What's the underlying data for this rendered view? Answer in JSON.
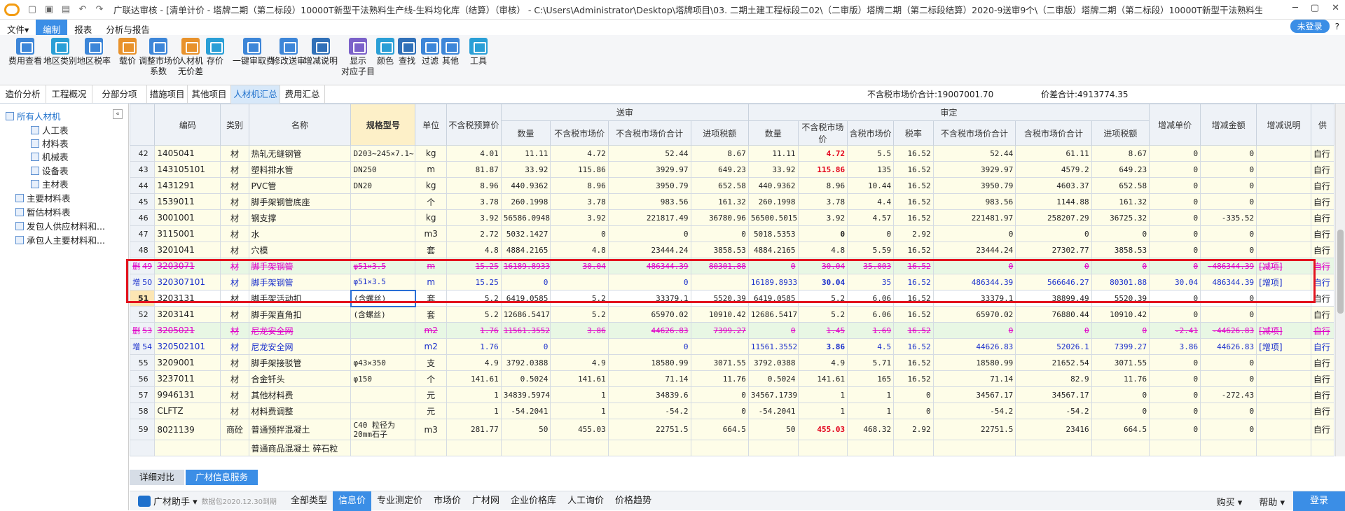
{
  "window": {
    "title": "广联达审核 - [清单计价 - 塔牌二期（第二标段）10000T新型干法熟料生产线-生料均化库（结算）（审核） - C:\\Users\\Administrator\\Desktop\\塔牌项目\\03. 二期土建工程标段二02\\（二审版）塔牌二期（第二标段结算）2020-9送审9个\\（二审版）塔牌二期（第二标段）10000T新型干法熟料生..."
  },
  "menu": {
    "items": [
      "文件▾",
      "编制",
      "报表",
      "分析与报告"
    ],
    "login": "未登录"
  },
  "ribbon": [
    {
      "label": "费用查看",
      "icon": "cost-view-icon"
    },
    {
      "label": "地区类别",
      "icon": "region-class-icon"
    },
    {
      "label": "地区税率",
      "icon": "region-tax-icon"
    },
    {
      "label": "载价",
      "icon": "load-price-icon"
    },
    {
      "label": "调整市场价\n系数",
      "icon": "adjust-price-icon"
    },
    {
      "label": "人材机\n无价差",
      "icon": "no-price-diff-icon"
    },
    {
      "label": "存价",
      "icon": "save-price-icon"
    },
    {
      "label": "一键审取费",
      "icon": "audit-fee-icon"
    },
    {
      "label": "修改送审",
      "icon": "edit-submit-icon"
    },
    {
      "label": "增减说明",
      "icon": "change-note-icon"
    },
    {
      "label": "显示\n对应子目",
      "icon": "show-sub-icon"
    },
    {
      "label": "颜色",
      "icon": "color-icon"
    },
    {
      "label": "查找",
      "icon": "find-icon"
    },
    {
      "label": "过滤",
      "icon": "filter-icon"
    },
    {
      "label": "其他",
      "icon": "other-icon"
    },
    {
      "label": "工具",
      "icon": "tools-icon"
    }
  ],
  "tabs": [
    "造价分析",
    "工程概况",
    "分部分项",
    "措施项目",
    "其他项目",
    "人材机汇总",
    "费用汇总"
  ],
  "summary": {
    "market_total": "不含税市场价合计:19007001.70",
    "price_diff": "价差合计:4913774.35"
  },
  "tree": [
    {
      "label": "所有人材机",
      "level": 0,
      "selected": true
    },
    {
      "label": "人工表",
      "level": 1
    },
    {
      "label": "材料表",
      "level": 1
    },
    {
      "label": "机械表",
      "level": 1
    },
    {
      "label": "设备表",
      "level": 1
    },
    {
      "label": "主材表",
      "level": 1
    },
    {
      "label": "主要材料表",
      "level": 0
    },
    {
      "label": "暂估材料表",
      "level": 0
    },
    {
      "label": "发包人供应材料和...",
      "level": 0
    },
    {
      "label": "承包人主要材料和...",
      "level": 0
    }
  ],
  "grid": {
    "head1": [
      "编码",
      "类别",
      "名称",
      "规格型号",
      "单位",
      "不含税预算价",
      "送审",
      "审定",
      "增减单价",
      "增减金额",
      "增减说明",
      "供"
    ],
    "head2": [
      "数量",
      "不含税市场价",
      "不含税市场价合计",
      "进项税额",
      "数量",
      "不含税市场价",
      "含税市场价",
      "税率",
      "不含税市场价合计",
      "含税市场价合计",
      "进项税额"
    ],
    "rows": [
      {
        "flag": "",
        "no": "42",
        "code": "1405041",
        "cat": "材",
        "name": "热轧无缝钢管",
        "spec": "D203~245×7.1~12",
        "unit": "kg",
        "budget": "4.01",
        "sq": "11.11",
        "sp": "4.72",
        "st": "52.44",
        "stax": "8.67",
        "aq": "11.11",
        "ap": "4.72",
        "aptax": "5.5",
        "rate": "16.52",
        "at": "52.44",
        "attax": "61.11",
        "atax": "8.67",
        "dp": "0",
        "da": "0",
        "note": "",
        "sup": "自行",
        "cls": "y",
        "apred": true
      },
      {
        "flag": "",
        "no": "43",
        "code": "143105101",
        "cat": "材",
        "name": "塑料排水管",
        "spec": "DN250",
        "unit": "m",
        "budget": "81.87",
        "sq": "33.92",
        "sp": "115.86",
        "st": "3929.97",
        "stax": "649.23",
        "aq": "33.92",
        "ap": "115.86",
        "aptax": "135",
        "rate": "16.52",
        "at": "3929.97",
        "attax": "4579.2",
        "atax": "649.23",
        "dp": "0",
        "da": "0",
        "note": "",
        "sup": "自行",
        "cls": "y",
        "apred": true
      },
      {
        "flag": "",
        "no": "44",
        "code": "1431291",
        "cat": "材",
        "name": "PVC管",
        "spec": "DN20",
        "unit": "kg",
        "budget": "8.96",
        "sq": "440.9362",
        "sp": "8.96",
        "st": "3950.79",
        "stax": "652.58",
        "aq": "440.9362",
        "ap": "8.96",
        "aptax": "10.44",
        "rate": "16.52",
        "at": "3950.79",
        "attax": "4603.37",
        "atax": "652.58",
        "dp": "0",
        "da": "0",
        "note": "",
        "sup": "自行",
        "cls": "y"
      },
      {
        "flag": "",
        "no": "45",
        "code": "1539011",
        "cat": "材",
        "name": "脚手架钢管底座",
        "spec": "",
        "unit": "个",
        "budget": "3.78",
        "sq": "260.1998",
        "sp": "3.78",
        "st": "983.56",
        "stax": "161.32",
        "aq": "260.1998",
        "ap": "3.78",
        "aptax": "4.4",
        "rate": "16.52",
        "at": "983.56",
        "attax": "1144.88",
        "atax": "161.32",
        "dp": "0",
        "da": "0",
        "note": "",
        "sup": "自行",
        "cls": "y"
      },
      {
        "flag": "",
        "no": "46",
        "code": "3001001",
        "cat": "材",
        "name": "钢支撑",
        "spec": "",
        "unit": "kg",
        "budget": "3.92",
        "sq": "56586.0948",
        "sp": "3.92",
        "st": "221817.49",
        "stax": "36780.96",
        "aq": "56500.5015",
        "ap": "3.92",
        "aptax": "4.57",
        "rate": "16.52",
        "at": "221481.97",
        "attax": "258207.29",
        "atax": "36725.32",
        "dp": "0",
        "da": "-335.52",
        "note": "",
        "sup": "自行",
        "cls": "y"
      },
      {
        "flag": "",
        "no": "47",
        "code": "3115001",
        "cat": "材",
        "name": "水",
        "spec": "",
        "unit": "m3",
        "budget": "2.72",
        "sq": "5032.1427",
        "sp": "0",
        "st": "0",
        "stax": "0",
        "aq": "5018.5353",
        "ap": "0",
        "aptax": "0",
        "rate": "2.92",
        "at": "0",
        "attax": "0",
        "atax": "0",
        "dp": "0",
        "da": "0",
        "note": "",
        "sup": "自行",
        "cls": "y",
        "apbold": true
      },
      {
        "flag": "",
        "no": "48",
        "code": "3201041",
        "cat": "材",
        "name": "穴模",
        "spec": "",
        "unit": "套",
        "budget": "4.8",
        "sq": "4884.2165",
        "sp": "4.8",
        "st": "23444.24",
        "stax": "3858.53",
        "aq": "4884.2165",
        "ap": "4.8",
        "aptax": "5.59",
        "rate": "16.52",
        "at": "23444.24",
        "attax": "27302.77",
        "atax": "3858.53",
        "dp": "0",
        "da": "0",
        "note": "",
        "sup": "自行",
        "cls": "y"
      },
      {
        "flag": "删",
        "no": "49",
        "code": "3203071",
        "cat": "材",
        "name": "脚手架钢管",
        "spec": "φ51×3.5",
        "unit": "m",
        "budget": "15.25",
        "sq": "16189.8933",
        "sp": "30.04",
        "st": "486344.39",
        "stax": "80301.88",
        "aq": "0",
        "ap": "30.04",
        "aptax": "35.003",
        "rate": "16.52",
        "at": "0",
        "attax": "0",
        "atax": "0",
        "dp": "0",
        "da": "-486344.39",
        "note": "[减项]",
        "sup": "自行",
        "cls": "del"
      },
      {
        "flag": "增",
        "no": "50",
        "code": "320307101",
        "cat": "材",
        "name": "脚手架钢管",
        "spec": "φ51×3.5",
        "unit": "m",
        "budget": "15.25",
        "sq": "0",
        "sp": "",
        "st": "0",
        "stax": "",
        "aq": "16189.8933",
        "ap": "30.04",
        "aptax": "35",
        "rate": "16.52",
        "at": "486344.39",
        "attax": "566646.27",
        "atax": "80301.88",
        "dp": "30.04",
        "da": "486344.39",
        "note": "[增项]",
        "sup": "自行",
        "cls": "add",
        "apbold": true
      },
      {
        "flag": "",
        "no": "51",
        "code": "3203131",
        "cat": "材",
        "name": "脚手架活动扣",
        "spec": "(含螺丝)",
        "unit": "套",
        "budget": "5.2",
        "sq": "6419.0585",
        "sp": "5.2",
        "st": "33379.1",
        "stax": "5520.39",
        "aq": "6419.0585",
        "ap": "5.2",
        "aptax": "6.06",
        "rate": "16.52",
        "at": "33379.1",
        "attax": "38899.49",
        "atax": "5520.39",
        "dp": "0",
        "da": "0",
        "note": "",
        "sup": "自行",
        "cls": "cur"
      },
      {
        "flag": "",
        "no": "52",
        "code": "3203141",
        "cat": "材",
        "name": "脚手架直角扣",
        "spec": "(含螺丝)",
        "unit": "套",
        "budget": "5.2",
        "sq": "12686.5417",
        "sp": "5.2",
        "st": "65970.02",
        "stax": "10910.42",
        "aq": "12686.5417",
        "ap": "5.2",
        "aptax": "6.06",
        "rate": "16.52",
        "at": "65970.02",
        "attax": "76880.44",
        "atax": "10910.42",
        "dp": "0",
        "da": "0",
        "note": "",
        "sup": "自行",
        "cls": "y"
      },
      {
        "flag": "删",
        "no": "53",
        "code": "3205021",
        "cat": "材",
        "name": "尼龙安全网",
        "spec": "",
        "unit": "m2",
        "budget": "1.76",
        "sq": "11561.3552",
        "sp": "3.86",
        "st": "44626.83",
        "stax": "7399.27",
        "aq": "0",
        "ap": "1.45",
        "aptax": "1.69",
        "rate": "16.52",
        "at": "0",
        "attax": "0",
        "atax": "0",
        "dp": "-2.41",
        "da": "-44626.83",
        "note": "[减项]",
        "sup": "自行",
        "cls": "del"
      },
      {
        "flag": "增",
        "no": "54",
        "code": "320502101",
        "cat": "材",
        "name": "尼龙安全网",
        "spec": "",
        "unit": "m2",
        "budget": "1.76",
        "sq": "0",
        "sp": "",
        "st": "0",
        "stax": "",
        "aq": "11561.3552",
        "ap": "3.86",
        "aptax": "4.5",
        "rate": "16.52",
        "at": "44626.83",
        "attax": "52026.1",
        "atax": "7399.27",
        "dp": "3.86",
        "da": "44626.83",
        "note": "[增项]",
        "sup": "自行",
        "cls": "add",
        "apbold": true
      },
      {
        "flag": "",
        "no": "55",
        "code": "3209001",
        "cat": "材",
        "name": "脚手架接驳管",
        "spec": "φ43×350",
        "unit": "支",
        "budget": "4.9",
        "sq": "3792.0388",
        "sp": "4.9",
        "st": "18580.99",
        "stax": "3071.55",
        "aq": "3792.0388",
        "ap": "4.9",
        "aptax": "5.71",
        "rate": "16.52",
        "at": "18580.99",
        "attax": "21652.54",
        "atax": "3071.55",
        "dp": "0",
        "da": "0",
        "note": "",
        "sup": "自行",
        "cls": "y"
      },
      {
        "flag": "",
        "no": "56",
        "code": "3237011",
        "cat": "材",
        "name": "合金钎头",
        "spec": "φ150",
        "unit": "个",
        "budget": "141.61",
        "sq": "0.5024",
        "sp": "141.61",
        "st": "71.14",
        "stax": "11.76",
        "aq": "0.5024",
        "ap": "141.61",
        "aptax": "165",
        "rate": "16.52",
        "at": "71.14",
        "attax": "82.9",
        "atax": "11.76",
        "dp": "0",
        "da": "0",
        "note": "",
        "sup": "自行",
        "cls": "y"
      },
      {
        "flag": "",
        "no": "57",
        "code": "9946131",
        "cat": "材",
        "name": "其他材料费",
        "spec": "",
        "unit": "元",
        "budget": "1",
        "sq": "34839.5974",
        "sp": "1",
        "st": "34839.6",
        "stax": "0",
        "aq": "34567.1739",
        "ap": "1",
        "aptax": "1",
        "rate": "0",
        "at": "34567.17",
        "attax": "34567.17",
        "atax": "0",
        "dp": "0",
        "da": "-272.43",
        "note": "",
        "sup": "自行",
        "cls": "y"
      },
      {
        "flag": "",
        "no": "58",
        "code": "CLFTZ",
        "cat": "材",
        "name": "材料费调整",
        "spec": "",
        "unit": "元",
        "budget": "1",
        "sq": "-54.2041",
        "sp": "1",
        "st": "-54.2",
        "stax": "0",
        "aq": "-54.2041",
        "ap": "1",
        "aptax": "1",
        "rate": "0",
        "at": "-54.2",
        "attax": "-54.2",
        "atax": "0",
        "dp": "0",
        "da": "0",
        "note": "",
        "sup": "自行",
        "cls": "y"
      },
      {
        "flag": "",
        "no": "59",
        "code": "8021139",
        "cat": "商砼",
        "name": "普通预拌混凝土",
        "spec": "C40 粒径为20mm石子",
        "unit": "m3",
        "budget": "281.77",
        "sq": "50",
        "sp": "455.03",
        "st": "22751.5",
        "stax": "664.5",
        "aq": "50",
        "ap": "455.03",
        "aptax": "468.32",
        "rate": "2.92",
        "at": "22751.5",
        "attax": "23416",
        "atax": "664.5",
        "dp": "0",
        "da": "0",
        "note": "",
        "sup": "自行",
        "cls": "y",
        "tall": true,
        "apred": true
      },
      {
        "flag": "",
        "no": "",
        "code": "",
        "cat": "",
        "name": "普通商品混凝土 碎石粒",
        "spec": "",
        "unit": "",
        "budget": "",
        "sq": "",
        "sp": "",
        "st": "",
        "stax": "",
        "aq": "",
        "ap": "",
        "aptax": "",
        "rate": "",
        "at": "",
        "attax": "",
        "atax": "",
        "dp": "",
        "da": "",
        "note": "",
        "sup": "",
        "cls": "y"
      }
    ]
  },
  "bottom_tabs": [
    "详细对比",
    "广材信息服务"
  ],
  "bottom_bar": {
    "brand": "广材助手 ▾",
    "note": "数据包2020.12.30到期",
    "items": [
      "全部类型",
      "信息价",
      "专业测定价",
      "市场价",
      "广材网",
      "企业价格库",
      "人工询价",
      "价格趋势"
    ],
    "right": [
      "购买 ▾",
      "帮助 ▾"
    ],
    "login": "登录"
  }
}
